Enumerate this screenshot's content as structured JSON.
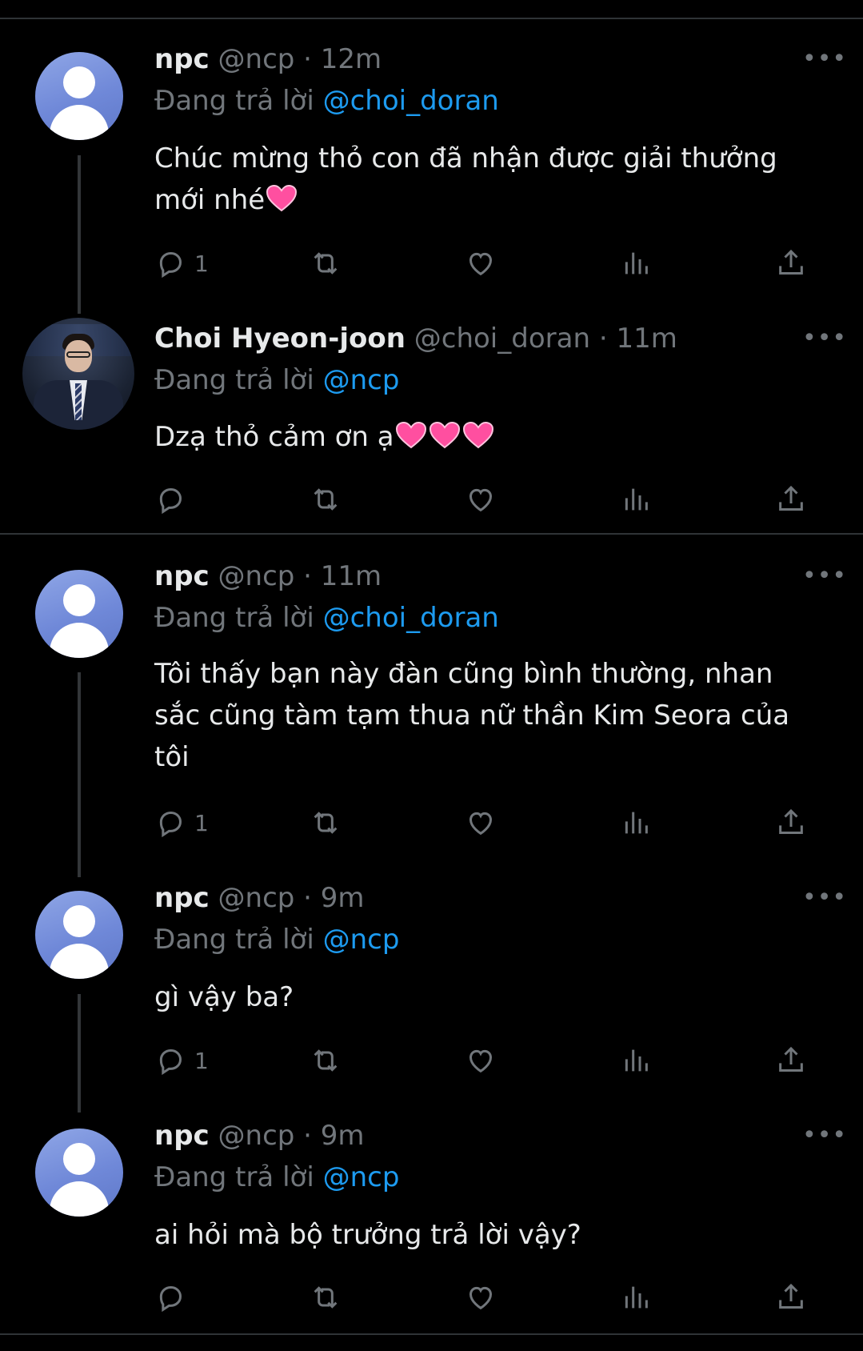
{
  "tweets": [
    {
      "name": "npc",
      "handle": "@ncp",
      "dot": "·",
      "time": "12m",
      "reply_prefix": "Đang trả lời",
      "reply_to": "@choi_doran",
      "text_lines": [
        "Chúc mừng thỏ con đã nhận được giải thưởng",
        "mới nhé"
      ],
      "hearts": 1,
      "reply_count": "1",
      "avatar": "default-avatar"
    },
    {
      "name": "Choi Hyeon-joon",
      "handle": "@choi_doran",
      "dot": "·",
      "time": "11m",
      "reply_prefix": "Đang trả lời",
      "reply_to": "@ncp",
      "text_lines": [
        "Dzạ thỏ cảm ơn ạ"
      ],
      "hearts": 3,
      "reply_count": "",
      "avatar": "profile-photo"
    },
    {
      "name": "npc",
      "handle": "@ncp",
      "dot": "·",
      "time": "11m",
      "reply_prefix": "Đang trả lời",
      "reply_to": "@choi_doran",
      "text_lines": [
        "Tôi thấy bạn này đàn cũng bình thường, nhan",
        "sắc cũng tàm tạm thua nữ thần Kim Seora của",
        "tôi"
      ],
      "hearts": 0,
      "reply_count": "1",
      "avatar": "default-avatar"
    },
    {
      "name": "npc",
      "handle": "@ncp",
      "dot": "·",
      "time": "9m",
      "reply_prefix": "Đang trả lời",
      "reply_to": "@ncp",
      "text_lines": [
        "gì vậy ba?"
      ],
      "hearts": 0,
      "reply_count": "1",
      "avatar": "default-avatar"
    },
    {
      "name": "npc",
      "handle": "@ncp",
      "dot": "·",
      "time": "9m",
      "reply_prefix": "Đang trả lời",
      "reply_to": "@ncp",
      "text_lines": [
        "ai hỏi mà bộ trưởng trả lời vậy?"
      ],
      "hearts": 0,
      "reply_count": "",
      "avatar": "default-avatar"
    }
  ],
  "more_label": "•••",
  "icons": {
    "reply": "reply-icon",
    "retweet": "retweet-icon",
    "like": "heart-icon",
    "views": "views-icon",
    "share": "share-icon",
    "emoji": "growing-heart-emoji"
  },
  "colors": {
    "background": "#000000",
    "text": "#e7e9ea",
    "muted": "#71767b",
    "link": "#1d9bf0",
    "emoji": "#ff4fa0"
  }
}
